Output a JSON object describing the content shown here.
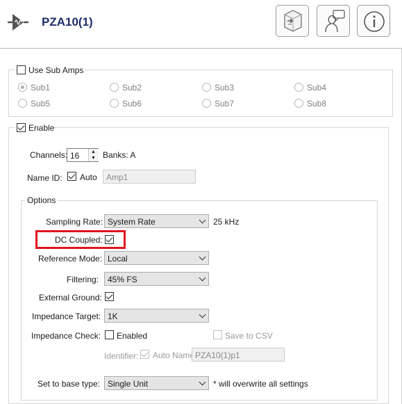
{
  "header": {
    "icon": "amplifier-waveform-icon",
    "title": "PZA10(1)",
    "buttons": [
      {
        "name": "configure-button",
        "icon": "cube-arrow-icon"
      },
      {
        "name": "notes-button",
        "icon": "person-speech-icon"
      },
      {
        "name": "info-button",
        "icon": "info-icon"
      }
    ]
  },
  "sub_amps": {
    "use_label": "Use Sub Amps",
    "use_checked": false,
    "options": [
      "Sub1",
      "Sub2",
      "Sub3",
      "Sub4",
      "Sub5",
      "Sub6",
      "Sub7",
      "Sub8"
    ],
    "selected": "Sub1"
  },
  "enable": {
    "label": "Enable",
    "checked": true,
    "channels_label": "Channels:",
    "channels_value": "16",
    "banks_text": "Banks: A",
    "name_id_label": "Name ID:",
    "auto_label": "Auto",
    "auto_checked": true,
    "name_placeholder": "Amp1"
  },
  "options": {
    "group_label": "Options",
    "sampling_rate_label": "Sampling Rate:",
    "sampling_rate_value": "System Rate",
    "sampling_rate_unit": "25 kHz",
    "dc_coupled_label": "DC Coupled:",
    "dc_coupled_checked": true,
    "reference_mode_label": "Reference Mode:",
    "reference_mode_value": "Local",
    "filtering_label": "Filtering:",
    "filtering_value": "45% FS",
    "external_ground_label": "External Ground:",
    "external_ground_checked": true,
    "impedance_target_label": "Impedance Target:",
    "impedance_target_value": "1K",
    "impedance_check_label": "Impedance Check:",
    "impedance_enabled_label": "Enabled",
    "save_csv_label": "Save to CSV",
    "identifier_label": "Identifier:",
    "auto_name_label": "Auto Name",
    "identifier_value": "PZA10(1)p1",
    "base_type_label": "Set to base type:",
    "base_type_value": "Single Unit",
    "base_type_note": "* will overwrite all settings"
  },
  "colors": {
    "title": "#1f2f6b",
    "highlight": "#e0141e"
  }
}
